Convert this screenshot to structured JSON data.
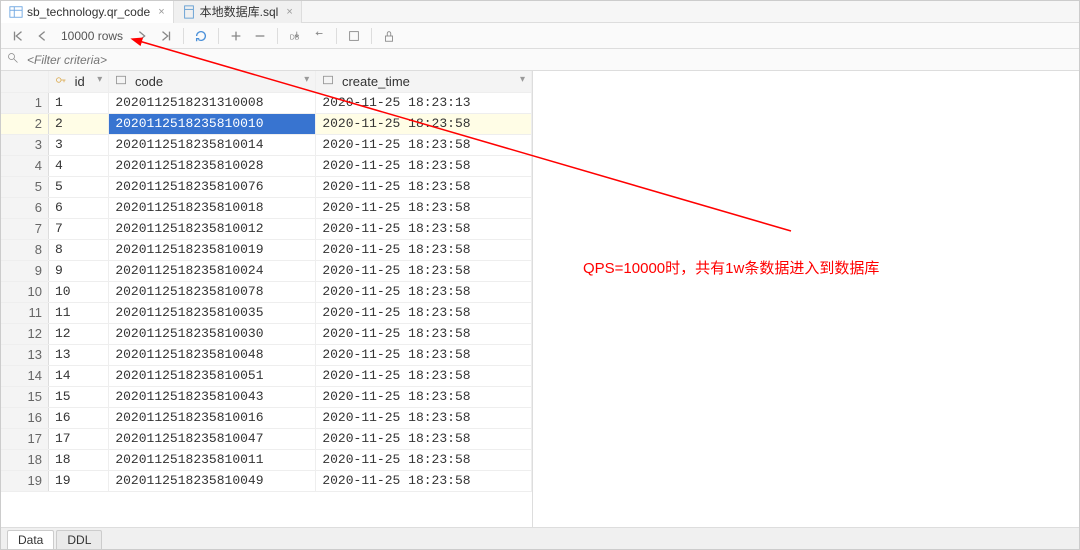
{
  "tabs": [
    {
      "label": "sb_technology.qr_code",
      "active": true
    },
    {
      "label": "本地数据库.sql",
      "active": false
    }
  ],
  "toolbar": {
    "row_count": "10000 rows"
  },
  "filter": {
    "placeholder": "<Filter criteria>"
  },
  "columns": {
    "id": "id",
    "code": "code",
    "create_time": "create_time"
  },
  "selected_row_index": 1,
  "selected_col": "code",
  "rows": [
    {
      "n": 1,
      "id": "1",
      "code": "2020112518231310008",
      "ct": "2020-11-25 18:23:13"
    },
    {
      "n": 2,
      "id": "2",
      "code": "2020112518235810010",
      "ct": "2020-11-25 18:23:58"
    },
    {
      "n": 3,
      "id": "3",
      "code": "2020112518235810014",
      "ct": "2020-11-25 18:23:58"
    },
    {
      "n": 4,
      "id": "4",
      "code": "2020112518235810028",
      "ct": "2020-11-25 18:23:58"
    },
    {
      "n": 5,
      "id": "5",
      "code": "2020112518235810076",
      "ct": "2020-11-25 18:23:58"
    },
    {
      "n": 6,
      "id": "6",
      "code": "2020112518235810018",
      "ct": "2020-11-25 18:23:58"
    },
    {
      "n": 7,
      "id": "7",
      "code": "2020112518235810012",
      "ct": "2020-11-25 18:23:58"
    },
    {
      "n": 8,
      "id": "8",
      "code": "2020112518235810019",
      "ct": "2020-11-25 18:23:58"
    },
    {
      "n": 9,
      "id": "9",
      "code": "2020112518235810024",
      "ct": "2020-11-25 18:23:58"
    },
    {
      "n": 10,
      "id": "10",
      "code": "2020112518235810078",
      "ct": "2020-11-25 18:23:58"
    },
    {
      "n": 11,
      "id": "11",
      "code": "2020112518235810035",
      "ct": "2020-11-25 18:23:58"
    },
    {
      "n": 12,
      "id": "12",
      "code": "2020112518235810030",
      "ct": "2020-11-25 18:23:58"
    },
    {
      "n": 13,
      "id": "13",
      "code": "2020112518235810048",
      "ct": "2020-11-25 18:23:58"
    },
    {
      "n": 14,
      "id": "14",
      "code": "2020112518235810051",
      "ct": "2020-11-25 18:23:58"
    },
    {
      "n": 15,
      "id": "15",
      "code": "2020112518235810043",
      "ct": "2020-11-25 18:23:58"
    },
    {
      "n": 16,
      "id": "16",
      "code": "2020112518235810016",
      "ct": "2020-11-25 18:23:58"
    },
    {
      "n": 17,
      "id": "17",
      "code": "2020112518235810047",
      "ct": "2020-11-25 18:23:58"
    },
    {
      "n": 18,
      "id": "18",
      "code": "2020112518235810011",
      "ct": "2020-11-25 18:23:58"
    },
    {
      "n": 19,
      "id": "19",
      "code": "2020112518235810049",
      "ct": "2020-11-25 18:23:58"
    }
  ],
  "bottom_tabs": {
    "data": "Data",
    "ddl": "DDL"
  },
  "annotation": {
    "text": "QPS=10000时，共有1w条数据进入到数据库"
  }
}
